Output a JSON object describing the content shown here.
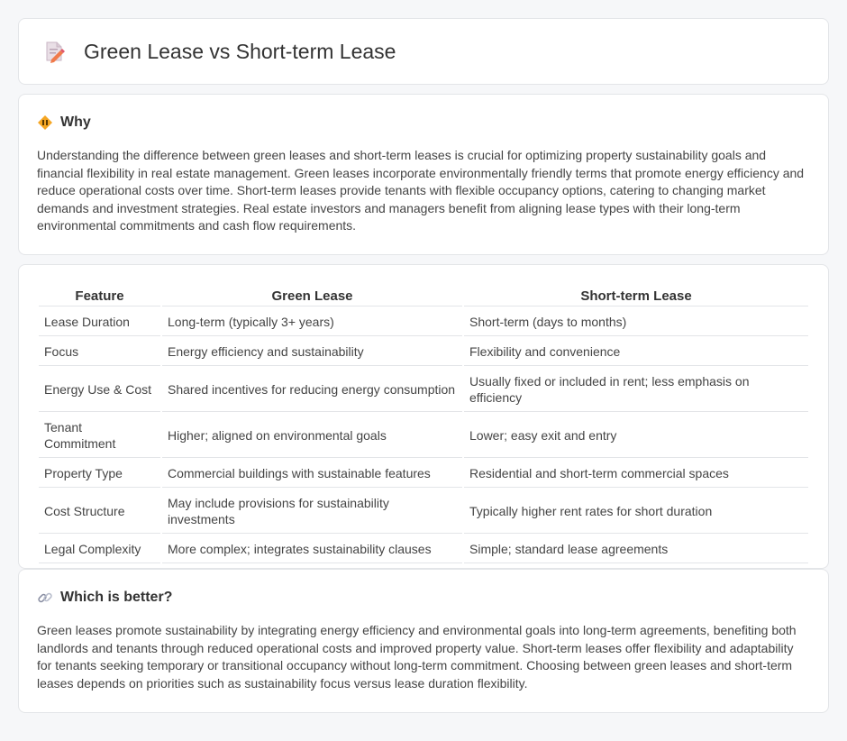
{
  "header": {
    "title": "Green Lease vs Short-term Lease",
    "icon": "document-pencil-icon"
  },
  "why": {
    "title": "Why",
    "icon": "diamond-warning-icon",
    "text": "Understanding the difference between green leases and short-term leases is crucial for optimizing property sustainability goals and financial flexibility in real estate management. Green leases incorporate environmentally friendly terms that promote energy efficiency and reduce operational costs over time. Short-term leases provide tenants with flexible occupancy options, catering to changing market demands and investment strategies. Real estate investors and managers benefit from aligning lease types with their long-term environmental commitments and cash flow requirements."
  },
  "table": {
    "headers": [
      "Feature",
      "Green Lease",
      "Short-term Lease"
    ],
    "rows": [
      [
        "Lease Duration",
        "Long-term (typically 3+ years)",
        "Short-term (days to months)"
      ],
      [
        "Focus",
        "Energy efficiency and sustainability",
        "Flexibility and convenience"
      ],
      [
        "Energy Use & Cost",
        "Shared incentives for reducing energy consumption",
        "Usually fixed or included in rent; less emphasis on efficiency"
      ],
      [
        "Tenant Commitment",
        "Higher; aligned on environmental goals",
        "Lower; easy exit and entry"
      ],
      [
        "Property Type",
        "Commercial buildings with sustainable features",
        "Residential and short-term commercial spaces"
      ],
      [
        "Cost Structure",
        "May include provisions for sustainability investments",
        "Typically higher rent rates for short duration"
      ],
      [
        "Legal Complexity",
        "More complex; integrates sustainability clauses",
        "Simple; standard lease agreements"
      ]
    ]
  },
  "better": {
    "title": "Which is better?",
    "icon": "link-icon",
    "text": "Green leases promote sustainability by integrating energy efficiency and environmental goals into long-term agreements, benefiting both landlords and tenants through reduced operational costs and improved property value. Short-term leases offer flexibility and adaptability for tenants seeking temporary or transitional occupancy without long-term commitment. Choosing between green leases and short-term leases depends on priorities such as sustainability focus versus lease duration flexibility."
  }
}
